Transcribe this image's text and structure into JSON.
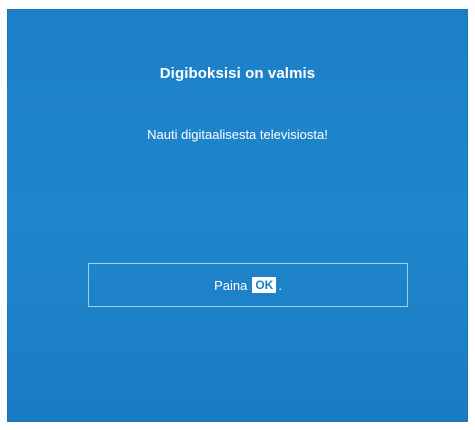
{
  "screen": {
    "title": "Digiboksisi on valmis",
    "subtitle": "Nauti digitaalisesta televisiosta!",
    "prompt": {
      "prefix": "Paina",
      "key_label": "OK",
      "suffix": "."
    }
  },
  "colors": {
    "background": "#1b7fc7",
    "text": "#ffffff"
  }
}
